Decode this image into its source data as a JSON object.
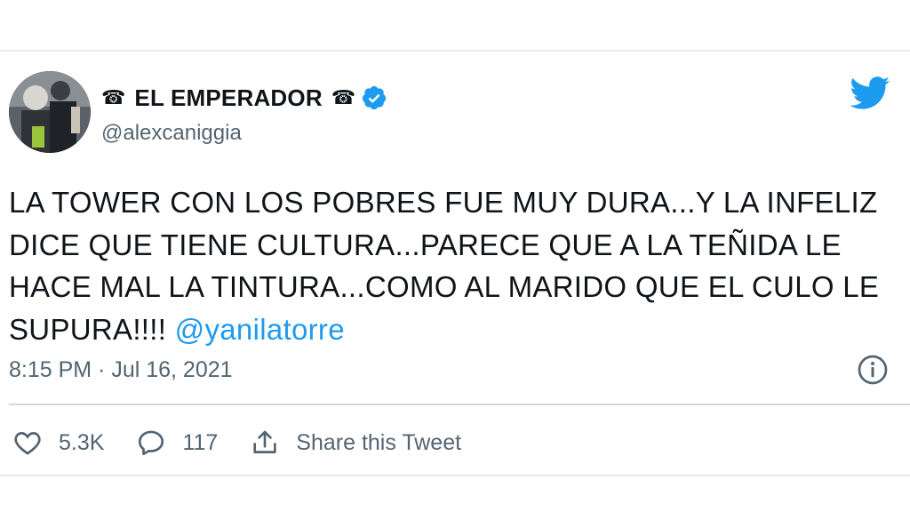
{
  "tweet": {
    "display_name": "EL EMPERADOR",
    "name_decoration_icon": "telephone-icon",
    "verified": true,
    "handle": "@alexcaniggia",
    "body_text": "LA TOWER CON LOS POBRES FUE MUY DURA...Y LA INFELIZ DICE QUE TIENE CULTURA...PARECE QUE A LA TEÑIDA LE HACE MAL LA TINTURA...COMO AL MARIDO QUE EL CULO LE SUPURA!!!! ",
    "mention": "@yanilatorre",
    "timestamp": "8:15 PM · Jul 16, 2021"
  },
  "actions": {
    "likes": "5.3K",
    "replies": "117",
    "share_label": "Share this Tweet"
  },
  "colors": {
    "brand_blue": "#1d9bf0",
    "text_primary": "#0f1419",
    "text_secondary": "#536471"
  }
}
